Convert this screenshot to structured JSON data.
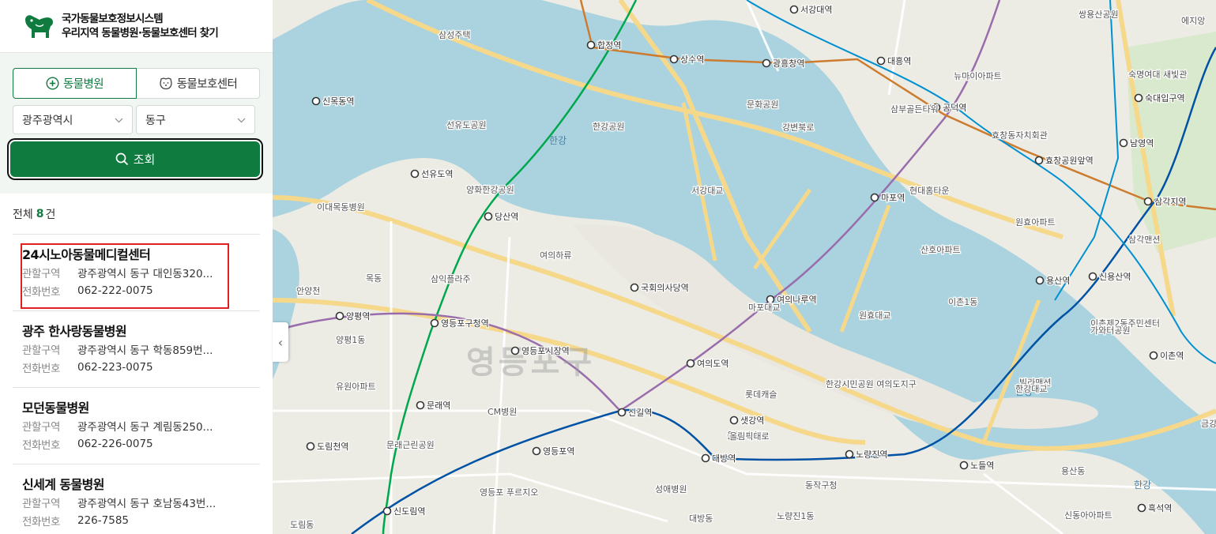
{
  "header": {
    "title": "국가동물보호정보시스템",
    "subtitle": "우리지역 동물병원·동물보호센터 찾기"
  },
  "tabs": [
    {
      "label": "동물병원",
      "active": true,
      "icon": "plus-circle-icon"
    },
    {
      "label": "동물보호센터",
      "active": false,
      "icon": "dog-face-icon"
    }
  ],
  "filters": {
    "city": "광주광역시",
    "district": "동구"
  },
  "search_button": {
    "label": "조회",
    "icon": "search-icon"
  },
  "results": {
    "count_prefix": "전체",
    "count": "8",
    "count_suffix": "건",
    "labels": {
      "area": "관할구역",
      "phone": "전화번호"
    },
    "items": [
      {
        "name": "24시노아동물메디컬센터",
        "area": "광주광역시 동구 대인동320...",
        "phone": "062-222-0075"
      },
      {
        "name": "광주 한사랑동물병원",
        "area": "광주광역시 동구 학동859번...",
        "phone": "062-223-0075"
      },
      {
        "name": "모던동물병원",
        "area": "광주광역시 동구 계림동250...",
        "phone": "062-226-0075"
      },
      {
        "name": "신세계 동물병원",
        "area": "광주광역시 동구 호남동43번...",
        "phone": "226-7585"
      }
    ]
  },
  "map": {
    "district_label": "영등포구",
    "river_labels": [
      "한강",
      "한강",
      "한강"
    ],
    "stations": [
      "합정역",
      "상수역",
      "광흥창역",
      "대흥역",
      "공덕역",
      "서강대역",
      "마포역",
      "효창공원앞역",
      "삼각지역",
      "남영역",
      "숙대입구역",
      "신목동역",
      "선유도역",
      "당산역",
      "국회의사당역",
      "여의나루역",
      "양평역",
      "영등포구청역",
      "영등포시장역",
      "여의도역",
      "신길역",
      "샛강역",
      "노량진역",
      "노들역",
      "대방역",
      "문래역",
      "도림천역",
      "영등포역",
      "신도림역",
      "신용산역",
      "용산역",
      "이촌역",
      "흑석역"
    ],
    "places": [
      "올림픽대로",
      "쌍용산공원",
      "삼성주택",
      "선유도공원",
      "양화한강공원",
      "문화공원",
      "한강공원",
      "강변북로",
      "삼부골든타워",
      "현대홈타운",
      "뉴마이아파트",
      "숙명여대 새빛관",
      "효창동자치회관",
      "원효아파트",
      "삼각맨션",
      "산호아파트",
      "이대목동병원",
      "여의하류",
      "삼익플라주",
      "목동",
      "유원아파트",
      "CM병원",
      "문래근린공원",
      "영등포 푸르지오",
      "성애병원",
      "롯데캐슬",
      "한강시민공원 여의도지구",
      "동작구청",
      "이촌제2동주민센터",
      "가와터공원",
      "빌라맨션",
      "신동아아파트",
      "마포대교",
      "서강대교",
      "원효대교",
      "한강대교",
      "안양천",
      "에지앙",
      "올림픽대로",
      "양평1동",
      "도림동",
      "대방동",
      "노량진1동",
      "용산동",
      "이촌1동",
      "금강"
    ]
  },
  "colors": {
    "brand": "#0f7b3f",
    "highlight": "#e02020",
    "line2": "#00a84d",
    "line5": "#996cac",
    "line6": "#cd7c2f",
    "line1": "#0052a4",
    "gyeongui": "#0090d2",
    "river": "#aad3df",
    "park": "#c8e6b0"
  }
}
